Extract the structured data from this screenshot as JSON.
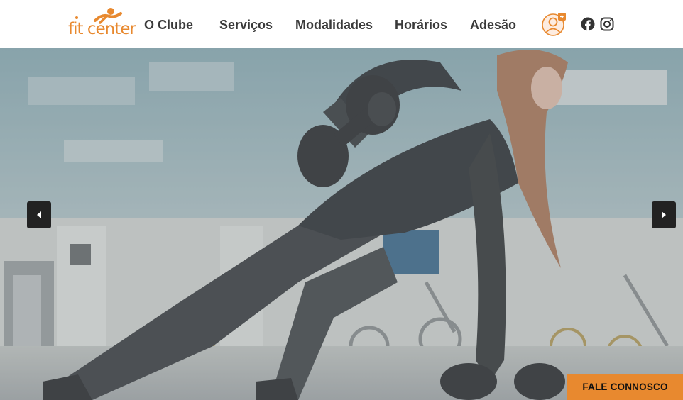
{
  "brand": {
    "logo_text": "fit center",
    "accent_color": "#e8892f"
  },
  "nav": {
    "items": [
      {
        "label": "O Clube"
      },
      {
        "label": "Serviços"
      },
      {
        "label": "Modalidades"
      },
      {
        "label": "Horários"
      },
      {
        "label": "Adesão"
      }
    ]
  },
  "header_icons": {
    "member": "member-area-icon",
    "facebook": "facebook-icon",
    "instagram": "instagram-icon"
  },
  "hero": {
    "image": "woman-dumbbell-row-gym-photo",
    "prev_icon": "arrow-left-icon",
    "next_icon": "arrow-right-icon"
  },
  "cta": {
    "label": "FALE CONNOSCO"
  }
}
